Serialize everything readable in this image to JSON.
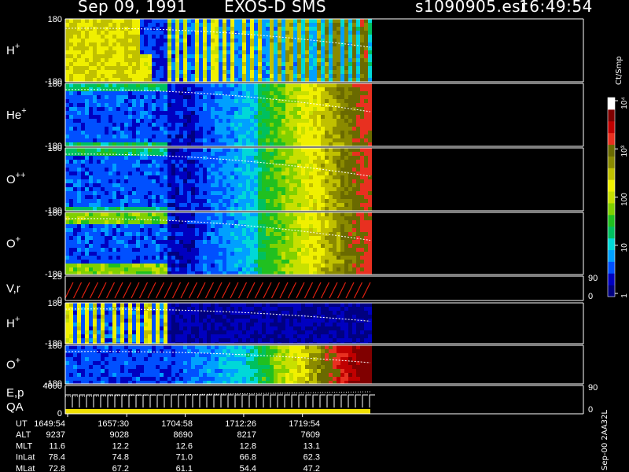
{
  "header": {
    "date": "Sep 09, 1991",
    "instrument": "EXOS-D SMS",
    "file": "s1090905.esr",
    "time": "16:49:54"
  },
  "colorbar": {
    "unit_label": "Ct/Smp",
    "ticks": [
      {
        "label": "10⁴",
        "value": 10000
      },
      {
        "label": "10³",
        "value": 1000
      },
      {
        "label": "100",
        "value": 100
      },
      {
        "label": "10",
        "value": 10
      },
      {
        "label": "1",
        "value": 1
      }
    ],
    "colors": [
      "#000080",
      "#0000c0",
      "#0050ff",
      "#00a0ff",
      "#00d8d8",
      "#00c060",
      "#20c020",
      "#80d000",
      "#c8e000",
      "#f0f000",
      "#c0c000",
      "#8a8a00",
      "#6a6a00",
      "#e83020",
      "#c00000",
      "#800000",
      "#ffffff"
    ]
  },
  "footer_code": "Sep-00 2AA32L",
  "chart_data": {
    "type": "heatmap",
    "x_time_labels": [
      "1649:54",
      "1657:30",
      "1704:58",
      "1712:26",
      "1719:54"
    ],
    "panels": [
      {
        "label": "H",
        "sup": "+",
        "yticks": [
          "180",
          "-180"
        ],
        "ylim": [
          -180,
          180
        ]
      },
      {
        "label": "He",
        "sup": "+",
        "yticks": [
          "180",
          "-180"
        ],
        "ylim": [
          -180,
          180
        ]
      },
      {
        "label": "O",
        "sup": "++",
        "yticks": [
          "180",
          "-180"
        ],
        "ylim": [
          -180,
          180
        ]
      },
      {
        "label": "O",
        "sup": "+",
        "yticks": [
          "180",
          "-180"
        ],
        "ylim": [
          -180,
          180
        ]
      },
      {
        "label": "V,r",
        "sup": "",
        "yticks": [
          "25",
          "0"
        ],
        "ylim": [
          0,
          25
        ],
        "right_ticks": [
          "90",
          "0"
        ]
      },
      {
        "label": "H",
        "sup": "+",
        "yticks": [
          "180",
          "-180"
        ],
        "ylim": [
          -180,
          180
        ]
      },
      {
        "label": "O",
        "sup": "+",
        "yticks": [
          "180",
          "-180"
        ],
        "ylim": [
          -180,
          180
        ]
      },
      {
        "label": "E,p",
        "label2": "QA",
        "sup": "",
        "yticks": [
          "4000",
          "0"
        ],
        "ylim": [
          0,
          4000
        ],
        "right_ticks": [
          "90",
          "0"
        ]
      }
    ],
    "orbit_table": {
      "rows": [
        {
          "name": "UT",
          "values": [
            "1649:54",
            "1657:30",
            "1704:58",
            "1712:26",
            "1719:54"
          ]
        },
        {
          "name": "ALT",
          "values": [
            "9237",
            "9028",
            "8690",
            "8217",
            "7609"
          ]
        },
        {
          "name": "MLT",
          "values": [
            "11.6",
            "12.2",
            "12.6",
            "12.8",
            "13.1"
          ]
        },
        {
          "name": "InLat",
          "values": [
            "78.4",
            "74.8",
            "71.0",
            "66.8",
            "62.3"
          ]
        },
        {
          "name": "MLat",
          "values": [
            "72.8",
            "67.2",
            "61.1",
            "54.4",
            "47.2"
          ]
        }
      ]
    }
  }
}
